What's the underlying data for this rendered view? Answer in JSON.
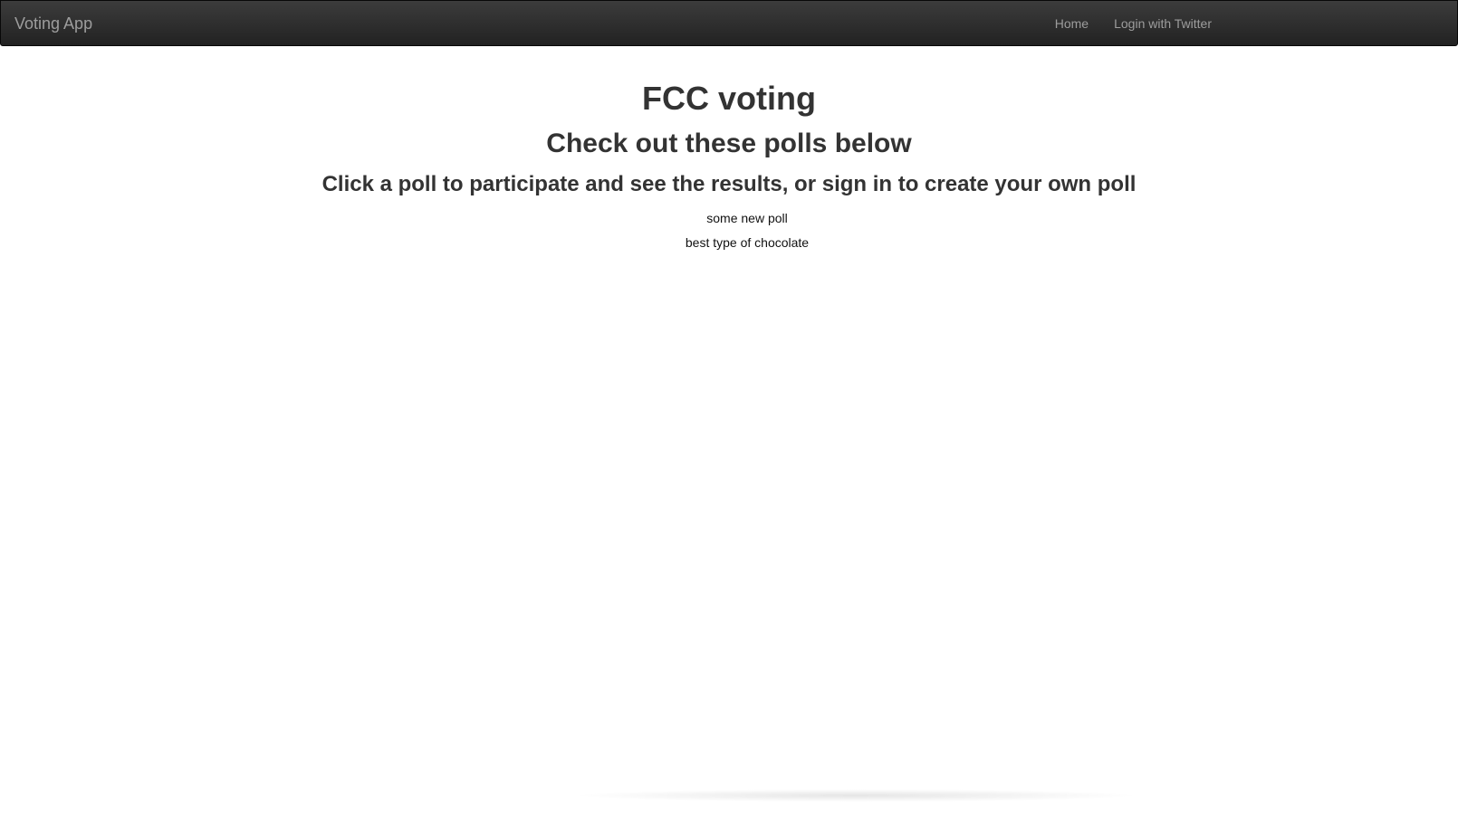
{
  "navbar": {
    "brand": "Voting App",
    "links": [
      {
        "label": "Home"
      },
      {
        "label": "Login with Twitter"
      }
    ]
  },
  "main": {
    "title": "FCC voting",
    "subtitle": "Check out these polls below",
    "instructions": "Click a poll to participate and see the results, or sign in to create your own poll",
    "polls": [
      {
        "label": "some new poll"
      },
      {
        "label": "best type of chocolate"
      }
    ]
  },
  "colors": {
    "navbar_bg": "#222222",
    "navbar_text": "#9d9d9d",
    "heading_text": "#333333"
  }
}
